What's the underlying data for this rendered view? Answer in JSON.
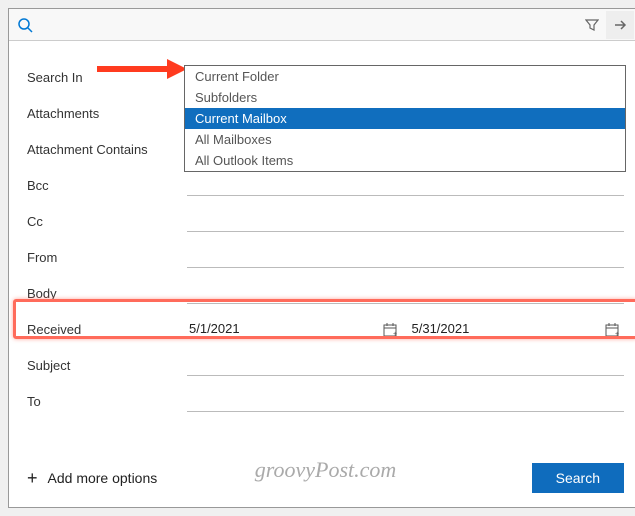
{
  "topbar": {
    "search_icon": "search-icon",
    "filter_icon": "filter-icon",
    "go_icon": "arrow-right-icon"
  },
  "fields": {
    "search_in": {
      "label": "Search In",
      "value": "Current Mailbox"
    },
    "attachments": {
      "label": "Attachments",
      "value": ""
    },
    "attachment_contains": {
      "label": "Attachment Contains",
      "value": ""
    },
    "bcc": {
      "label": "Bcc",
      "value": ""
    },
    "cc": {
      "label": "Cc",
      "value": ""
    },
    "from": {
      "label": "From",
      "value": ""
    },
    "body": {
      "label": "Body",
      "value": ""
    },
    "received": {
      "label": "Received",
      "start": "5/1/2021",
      "end": "5/31/2021"
    },
    "subject": {
      "label": "Subject",
      "value": ""
    },
    "to": {
      "label": "To",
      "value": ""
    }
  },
  "dropdown": {
    "options": {
      "0": "Current Folder",
      "1": "Subfolders",
      "2": "Current Mailbox",
      "3": "All Mailboxes",
      "4": "All Outlook Items"
    },
    "selected_index": 2
  },
  "footer": {
    "add_more": "Add more options",
    "search_button": "Search"
  },
  "watermark": "groovyPost.com"
}
